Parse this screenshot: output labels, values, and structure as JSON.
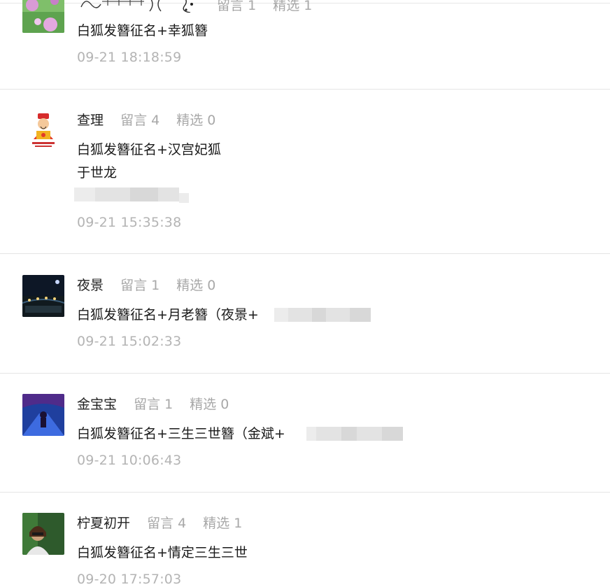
{
  "comments": [
    {
      "name": "",
      "messages_label": "留言 1",
      "featured_label": "精选 1",
      "lines": [
        "白狐发簪征名+幸狐簪"
      ],
      "time": "09-21 18:18:59",
      "avatar_icon": "flower-photo-avatar"
    },
    {
      "name": "查理",
      "messages_label": "留言 4",
      "featured_label": "精选 0",
      "lines": [
        "白狐发簪征名+汉宫妃狐",
        "于世龙"
      ],
      "time": "09-21 15:35:38",
      "avatar_icon": "god-of-wealth-avatar"
    },
    {
      "name": "夜景",
      "messages_label": "留言 1",
      "featured_label": "精选 0",
      "lines": [
        "白狐发簪征名+月老簪（夜景+"
      ],
      "time": "09-21 15:02:33",
      "avatar_icon": "night-scene-avatar"
    },
    {
      "name": "金宝宝",
      "messages_label": "留言 1",
      "featured_label": "精选 0",
      "lines": [
        "白狐发簪征名+三生三世簪（金斌+"
      ],
      "time": "09-21 10:06:43",
      "avatar_icon": "blue-path-avatar"
    },
    {
      "name": "柠夏初开",
      "messages_label": "留言 4",
      "featured_label": "精选 1",
      "lines": [
        "白狐发簪征名+情定三生三世"
      ],
      "time": "09-20 17:57:03",
      "avatar_icon": "woman-portrait-avatar"
    }
  ],
  "colors": {
    "name": "#222222",
    "stat": "#a8a8a8",
    "time": "#b4b4b4",
    "separator": "#e5e5e5"
  }
}
